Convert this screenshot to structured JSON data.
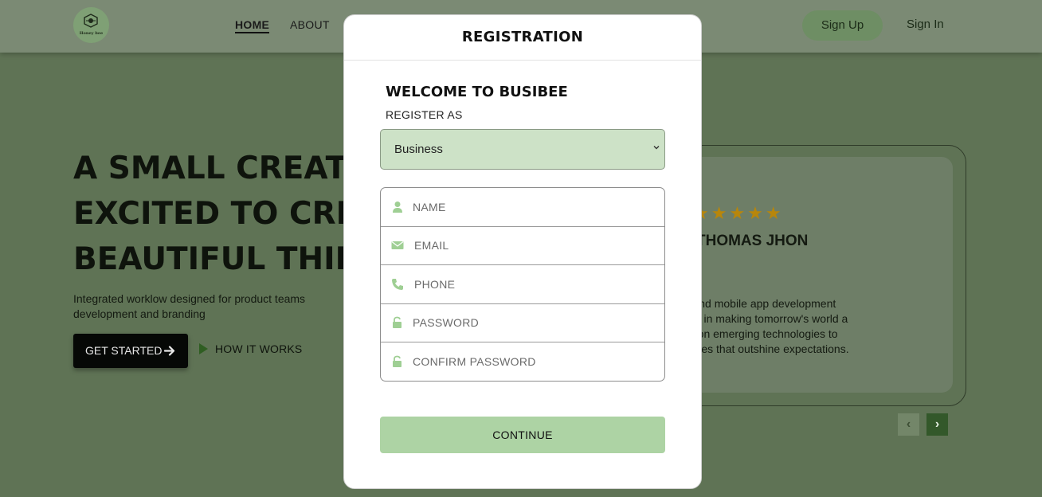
{
  "navbar": {
    "logo_text": "Honey bee",
    "links": [
      "HOME",
      "ABOUT"
    ],
    "signup_label": "Sign Up",
    "signin_label": "Sign In"
  },
  "hero": {
    "title_lines": [
      "A SMALL CREATIV",
      "EXCITED TO CREA",
      "BEAUTIFUL THING"
    ],
    "subtitle_lines": [
      "Integrated worklow designed for product teams",
      "development and branding"
    ],
    "get_started_label": "GET STARTED",
    "how_it_works_label": "HOW IT WORKS"
  },
  "testimonial": {
    "stars": "★★★★★",
    "name": "THOMAS JHON",
    "body_lines": [
      "eb and mobile app development",
      "eves in making tomorrow's world a",
      "cus on emerging technologies to",
      "riences that outshine expectations."
    ],
    "prev_symbol": "‹",
    "next_symbol": "›"
  },
  "modal": {
    "title": "REGISTRATION",
    "welcome": "WELCOME TO BUSIBEE",
    "register_as_label": "REGISTER AS",
    "register_as_value": "Business",
    "fields": [
      {
        "placeholder": "NAME",
        "icon": "user-icon"
      },
      {
        "placeholder": "EMAIL",
        "icon": "envelope-icon"
      },
      {
        "placeholder": "PHONE",
        "icon": "phone-icon"
      },
      {
        "placeholder": "PASSWORD",
        "icon": "lock-icon"
      },
      {
        "placeholder": "CONFIRM PASSWORD",
        "icon": "lock-icon"
      }
    ],
    "continue_label": "CONTINUE"
  },
  "colors": {
    "overlay_background": "#5f7355",
    "select_fill": "#cde2c7",
    "continue_fill": "#add3a4",
    "icon_green": "#9fcf94"
  }
}
